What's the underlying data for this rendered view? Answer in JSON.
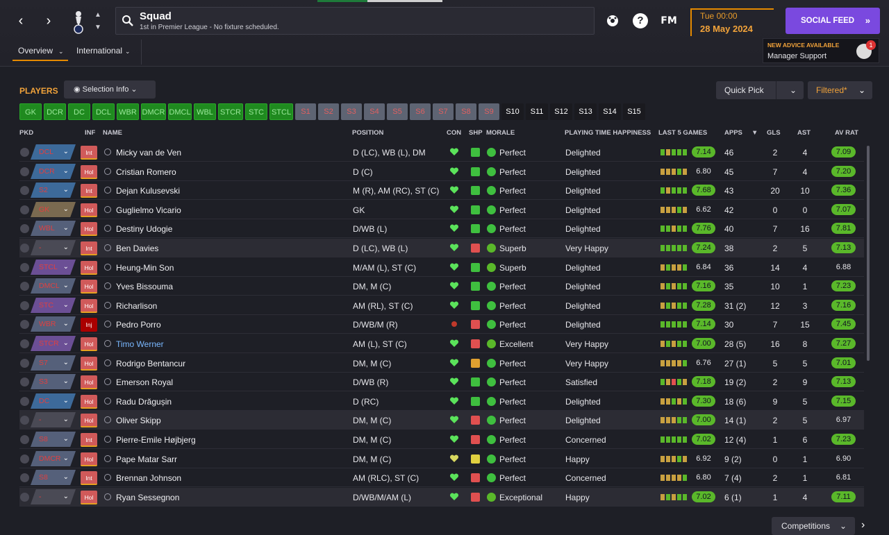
{
  "header": {
    "back_icon": "chevron-left-icon",
    "forward_icon": "chevron-right-icon",
    "club_crest": "club-crest-icon",
    "search_title": "Squad",
    "search_subtitle": "1st in Premier League - No fixture scheduled.",
    "time": "Tue 00:00",
    "date": "28 May 2024",
    "fm_label": "FM",
    "help_label": "?",
    "social_feed_label": "SOCIAL FEED",
    "social_feed_chevron": "»",
    "advice_title": "NEW ADVICE AVAILABLE",
    "advice_subtitle": "Manager Support",
    "advice_badge": "1",
    "accent_color": "#7a49df"
  },
  "tabs": [
    {
      "label": "Overview",
      "active": true
    },
    {
      "label": "International",
      "active": false
    }
  ],
  "toolbar": {
    "players_label": "PLAYERS",
    "selection_info": "Selection Info",
    "quick_pick": "Quick Pick",
    "filtered": "Filtered*",
    "competitions": "Competitions"
  },
  "position_filters": [
    {
      "label": "GK",
      "state": "green"
    },
    {
      "label": "DCR",
      "state": "green"
    },
    {
      "label": "DC",
      "state": "green"
    },
    {
      "label": "DCL",
      "state": "green"
    },
    {
      "label": "WBR",
      "state": "green"
    },
    {
      "label": "DMCR",
      "state": "green"
    },
    {
      "label": "DMCL",
      "state": "green"
    },
    {
      "label": "WBL",
      "state": "green"
    },
    {
      "label": "STCR",
      "state": "green"
    },
    {
      "label": "STC",
      "state": "green"
    },
    {
      "label": "STCL",
      "state": "green"
    },
    {
      "label": "S1",
      "state": "sub"
    },
    {
      "label": "S2",
      "state": "sub"
    },
    {
      "label": "S3",
      "state": "sub"
    },
    {
      "label": "S4",
      "state": "sub"
    },
    {
      "label": "S5",
      "state": "sub"
    },
    {
      "label": "S6",
      "state": "sub"
    },
    {
      "label": "S7",
      "state": "sub"
    },
    {
      "label": "S8",
      "state": "sub"
    },
    {
      "label": "S9",
      "state": "sub"
    },
    {
      "label": "S10",
      "state": "dark"
    },
    {
      "label": "S11",
      "state": "dark"
    },
    {
      "label": "S12",
      "state": "dark"
    },
    {
      "label": "S13",
      "state": "dark"
    },
    {
      "label": "S14",
      "state": "dark"
    },
    {
      "label": "S15",
      "state": "dark"
    }
  ],
  "columns": {
    "pkd": "PKD",
    "inf": "INF",
    "name": "NAME",
    "position": "POSITION",
    "con": "CON",
    "shp": "SHP",
    "morale": "MORALE",
    "pth": "PLAYING TIME HAPPINESS",
    "last5": "LAST 5 GAMES",
    "apps": "APPS",
    "apps_sort": "▼",
    "gls": "GLS",
    "ast": "AST",
    "avrat": "AV RAT"
  },
  "players": [
    {
      "pkd": "DCL",
      "pkd_color": "#3d6a9a",
      "inf": "Int",
      "name": "Micky van de Ven",
      "position": "D (LC), WB (L), DM",
      "con": "#5be35b",
      "shp": "#3fbf3f",
      "morale_color": "#3fbf3f",
      "morale": "Perfect",
      "pth": "Delighted",
      "form": [
        "#5ab82a",
        "#c8a040",
        "#5ab82a",
        "#5ab82a",
        "#5ab82a"
      ],
      "last_rating": "7.14",
      "last_good": true,
      "apps": "46",
      "gls": "2",
      "ast": "4",
      "avrat": "7.09",
      "av_good": true,
      "hl": false,
      "blue": false
    },
    {
      "pkd": "DCR",
      "pkd_color": "#3d6a9a",
      "inf": "Hol",
      "name": "Cristian Romero",
      "position": "D (C)",
      "con": "#5be35b",
      "shp": "#3fbf3f",
      "morale_color": "#3fbf3f",
      "morale": "Perfect",
      "pth": "Delighted",
      "form": [
        "#c8a040",
        "#c8a040",
        "#c8a040",
        "#5ab82a",
        "#c8a040"
      ],
      "last_rating": "6.80",
      "last_good": false,
      "apps": "45",
      "gls": "7",
      "ast": "4",
      "avrat": "7.20",
      "av_good": true,
      "hl": false,
      "blue": false
    },
    {
      "pkd": "S2",
      "pkd_color": "#3d6a9a",
      "inf": "Int",
      "name": "Dejan Kulusevski",
      "position": "M (R), AM (RC), ST (C)",
      "con": "#5be35b",
      "shp": "#3fbf3f",
      "morale_color": "#3fbf3f",
      "morale": "Perfect",
      "pth": "Delighted",
      "form": [
        "#5ab82a",
        "#c8a040",
        "#5ab82a",
        "#5ab82a",
        "#5ab82a"
      ],
      "last_rating": "7.68",
      "last_good": true,
      "apps": "43",
      "gls": "20",
      "ast": "10",
      "avrat": "7.36",
      "av_good": true,
      "hl": false,
      "blue": false
    },
    {
      "pkd": "GK",
      "pkd_color": "#7a6a50",
      "inf": "Hol",
      "name": "Guglielmo Vicario",
      "position": "GK",
      "con": "#5be35b",
      "shp": "#3fbf3f",
      "morale_color": "#3fbf3f",
      "morale": "Perfect",
      "pth": "Delighted",
      "form": [
        "#c8a040",
        "#c8a040",
        "#c8a040",
        "#5ab82a",
        "#c8a040"
      ],
      "last_rating": "6.62",
      "last_good": false,
      "apps": "42",
      "gls": "0",
      "ast": "0",
      "avrat": "7.07",
      "av_good": true,
      "hl": false,
      "blue": false
    },
    {
      "pkd": "WBL",
      "pkd_color": "#55607a",
      "inf": "Hol",
      "name": "Destiny Udogie",
      "position": "D/WB (L)",
      "con": "#5be35b",
      "shp": "#3fbf3f",
      "morale_color": "#3fbf3f",
      "morale": "Perfect",
      "pth": "Delighted",
      "form": [
        "#5ab82a",
        "#5ab82a",
        "#c8a040",
        "#5ab82a",
        "#5ab82a"
      ],
      "last_rating": "7.76",
      "last_good": true,
      "apps": "40",
      "gls": "7",
      "ast": "16",
      "avrat": "7.81",
      "av_good": true,
      "hl": false,
      "blue": false
    },
    {
      "pkd": "-",
      "pkd_color": "#4a4a55",
      "inf": "Int",
      "name": "Ben Davies",
      "position": "D (LC), WB (L)",
      "con": "#5be35b",
      "shp": "#e05050",
      "morale_color": "#5ab82a",
      "morale": "Superb",
      "pth": "Very Happy",
      "form": [
        "#5ab82a",
        "#5ab82a",
        "#5ab82a",
        "#5ab82a",
        "#5ab82a"
      ],
      "last_rating": "7.24",
      "last_good": true,
      "apps": "38",
      "gls": "2",
      "ast": "5",
      "avrat": "7.13",
      "av_good": true,
      "hl": true,
      "blue": false
    },
    {
      "pkd": "STCL",
      "pkd_color": "#6b4f95",
      "inf": "Hol",
      "name": "Heung-Min Son",
      "position": "M/AM (L), ST (C)",
      "con": "#5be35b",
      "shp": "#3fbf3f",
      "morale_color": "#5ab82a",
      "morale": "Superb",
      "pth": "Delighted",
      "form": [
        "#c8a040",
        "#5ab82a",
        "#c8a040",
        "#c8a040",
        "#5ab82a"
      ],
      "last_rating": "6.84",
      "last_good": false,
      "apps": "36",
      "gls": "14",
      "ast": "4",
      "avrat": "6.88",
      "av_good": false,
      "hl": false,
      "blue": false
    },
    {
      "pkd": "DMCL",
      "pkd_color": "#55607a",
      "inf": "Hol",
      "name": "Yves Bissouma",
      "position": "DM, M (C)",
      "con": "#5be35b",
      "shp": "#3fbf3f",
      "morale_color": "#3fbf3f",
      "morale": "Perfect",
      "pth": "Delighted",
      "form": [
        "#c8a040",
        "#5ab82a",
        "#c8a040",
        "#5ab82a",
        "#5ab82a"
      ],
      "last_rating": "7.16",
      "last_good": true,
      "apps": "35",
      "gls": "10",
      "ast": "1",
      "avrat": "7.23",
      "av_good": true,
      "hl": false,
      "blue": false
    },
    {
      "pkd": "STC",
      "pkd_color": "#6b4f95",
      "inf": "Hol",
      "name": "Richarlison",
      "position": "AM (RL), ST (C)",
      "con": "#5be35b",
      "shp": "#3fbf3f",
      "morale_color": "#3fbf3f",
      "morale": "Perfect",
      "pth": "Delighted",
      "form": [
        "#c8a040",
        "#5ab82a",
        "#c8a040",
        "#5ab82a",
        "#5ab82a"
      ],
      "last_rating": "7.28",
      "last_good": true,
      "apps": "31 (2)",
      "gls": "12",
      "ast": "3",
      "avrat": "7.16",
      "av_good": true,
      "hl": false,
      "blue": false
    },
    {
      "pkd": "WBR",
      "pkd_color": "#55607a",
      "inf": "Inj",
      "name": "Pedro Porro",
      "position": "D/WB/M (R)",
      "con": "#c0392b",
      "shp": "#e05050",
      "morale_color": "#3fbf3f",
      "morale": "Perfect",
      "pth": "Delighted",
      "form": [
        "#5ab82a",
        "#5ab82a",
        "#5ab82a",
        "#5ab82a",
        "#5ab82a"
      ],
      "last_rating": "7.14",
      "last_good": true,
      "apps": "30",
      "gls": "7",
      "ast": "15",
      "avrat": "7.45",
      "av_good": true,
      "hl": false,
      "blue": false
    },
    {
      "pkd": "STCR",
      "pkd_color": "#6b4f95",
      "inf": "Hol",
      "name": "Timo Werner",
      "position": "AM (L), ST (C)",
      "con": "#5be35b",
      "shp": "#e05050",
      "morale_color": "#5ab82a",
      "morale": "Excellent",
      "pth": "Very Happy",
      "form": [
        "#c8a040",
        "#5ab82a",
        "#c8a040",
        "#5ab82a",
        "#5ab82a"
      ],
      "last_rating": "7.00",
      "last_good": true,
      "apps": "28 (5)",
      "gls": "16",
      "ast": "8",
      "avrat": "7.27",
      "av_good": true,
      "hl": false,
      "blue": true
    },
    {
      "pkd": "S7",
      "pkd_color": "#55607a",
      "inf": "Hol",
      "name": "Rodrigo Bentancur",
      "position": "DM, M (C)",
      "con": "#5be35b",
      "shp": "#e0a030",
      "morale_color": "#3fbf3f",
      "morale": "Perfect",
      "pth": "Very Happy",
      "form": [
        "#c8a040",
        "#c8a040",
        "#c8a040",
        "#c8a040",
        "#5ab82a"
      ],
      "last_rating": "6.76",
      "last_good": false,
      "apps": "27 (1)",
      "gls": "5",
      "ast": "5",
      "avrat": "7.01",
      "av_good": true,
      "hl": false,
      "blue": false
    },
    {
      "pkd": "S3",
      "pkd_color": "#55607a",
      "inf": "Hol",
      "name": "Emerson Royal",
      "position": "D/WB (R)",
      "con": "#5be35b",
      "shp": "#3fbf3f",
      "morale_color": "#3fbf3f",
      "morale": "Perfect",
      "pth": "Satisfied",
      "form": [
        "#5ab82a",
        "#c8a040",
        "#e05050",
        "#5ab82a",
        "#c8a040"
      ],
      "last_rating": "7.18",
      "last_good": true,
      "apps": "19 (2)",
      "gls": "2",
      "ast": "9",
      "avrat": "7.13",
      "av_good": true,
      "hl": false,
      "blue": false
    },
    {
      "pkd": "DC",
      "pkd_color": "#3d6a9a",
      "inf": "Hol",
      "name": "Radu Drăgușin",
      "position": "D (RC)",
      "con": "#5be35b",
      "shp": "#3fbf3f",
      "morale_color": "#3fbf3f",
      "morale": "Perfect",
      "pth": "Delighted",
      "form": [
        "#c8a040",
        "#c8a040",
        "#5ab82a",
        "#c8a040",
        "#5ab82a"
      ],
      "last_rating": "7.30",
      "last_good": true,
      "apps": "18 (6)",
      "gls": "9",
      "ast": "5",
      "avrat": "7.15",
      "av_good": true,
      "hl": false,
      "blue": false
    },
    {
      "pkd": "-",
      "pkd_color": "#4a4a55",
      "inf": "Hol",
      "name": "Oliver Skipp",
      "position": "DM, M (C)",
      "con": "#5be35b",
      "shp": "#e05050",
      "morale_color": "#3fbf3f",
      "morale": "Perfect",
      "pth": "Delighted",
      "form": [
        "#c8a040",
        "#c8a040",
        "#c8a040",
        "#5ab82a",
        "#5ab82a"
      ],
      "last_rating": "7.00",
      "last_good": true,
      "apps": "14 (1)",
      "gls": "2",
      "ast": "5",
      "avrat": "6.97",
      "av_good": false,
      "hl": true,
      "blue": false
    },
    {
      "pkd": "S8",
      "pkd_color": "#55607a",
      "inf": "Int",
      "name": "Pierre-Emile Højbjerg",
      "position": "DM, M (C)",
      "con": "#5be35b",
      "shp": "#e05050",
      "morale_color": "#3fbf3f",
      "morale": "Perfect",
      "pth": "Concerned",
      "form": [
        "#5ab82a",
        "#5ab82a",
        "#5ab82a",
        "#5ab82a",
        "#5ab82a"
      ],
      "last_rating": "7.02",
      "last_good": true,
      "apps": "12 (4)",
      "gls": "1",
      "ast": "6",
      "avrat": "7.23",
      "av_good": true,
      "hl": false,
      "blue": false
    },
    {
      "pkd": "DMCR",
      "pkd_color": "#55607a",
      "inf": "Hol",
      "name": "Pape Matar Sarr",
      "position": "DM, M (C)",
      "con": "#d8d860",
      "shp": "#e0d040",
      "morale_color": "#3fbf3f",
      "morale": "Perfect",
      "pth": "Happy",
      "form": [
        "#c8a040",
        "#c8a040",
        "#c8a040",
        "#5ab82a",
        "#c8a040"
      ],
      "last_rating": "6.92",
      "last_good": false,
      "apps": "9 (2)",
      "gls": "0",
      "ast": "1",
      "avrat": "6.90",
      "av_good": false,
      "hl": false,
      "blue": false
    },
    {
      "pkd": "S8",
      "pkd_color": "#55607a",
      "inf": "Int",
      "name": "Brennan Johnson",
      "position": "AM (RLC), ST (C)",
      "con": "#5be35b",
      "shp": "#e05050",
      "morale_color": "#3fbf3f",
      "morale": "Perfect",
      "pth": "Concerned",
      "form": [
        "#c8a040",
        "#c8a040",
        "#c8a040",
        "#c8a040",
        "#5ab82a"
      ],
      "last_rating": "6.80",
      "last_good": false,
      "apps": "7 (4)",
      "gls": "2",
      "ast": "1",
      "avrat": "6.81",
      "av_good": false,
      "hl": false,
      "blue": false
    },
    {
      "pkd": "-",
      "pkd_color": "#4a4a55",
      "inf": "Hol",
      "name": "Ryan Sessegnon",
      "position": "D/WB/M/AM (L)",
      "con": "#5be35b",
      "shp": "#e05050",
      "morale_color": "#5ab82a",
      "morale": "Exceptional",
      "pth": "Happy",
      "form": [
        "#c8a040",
        "#5ab82a",
        "#c8a040",
        "#5ab82a",
        "#5ab82a"
      ],
      "last_rating": "7.02",
      "last_good": true,
      "apps": "6 (1)",
      "gls": "1",
      "ast": "4",
      "avrat": "7.11",
      "av_good": true,
      "hl": true,
      "blue": false
    }
  ]
}
